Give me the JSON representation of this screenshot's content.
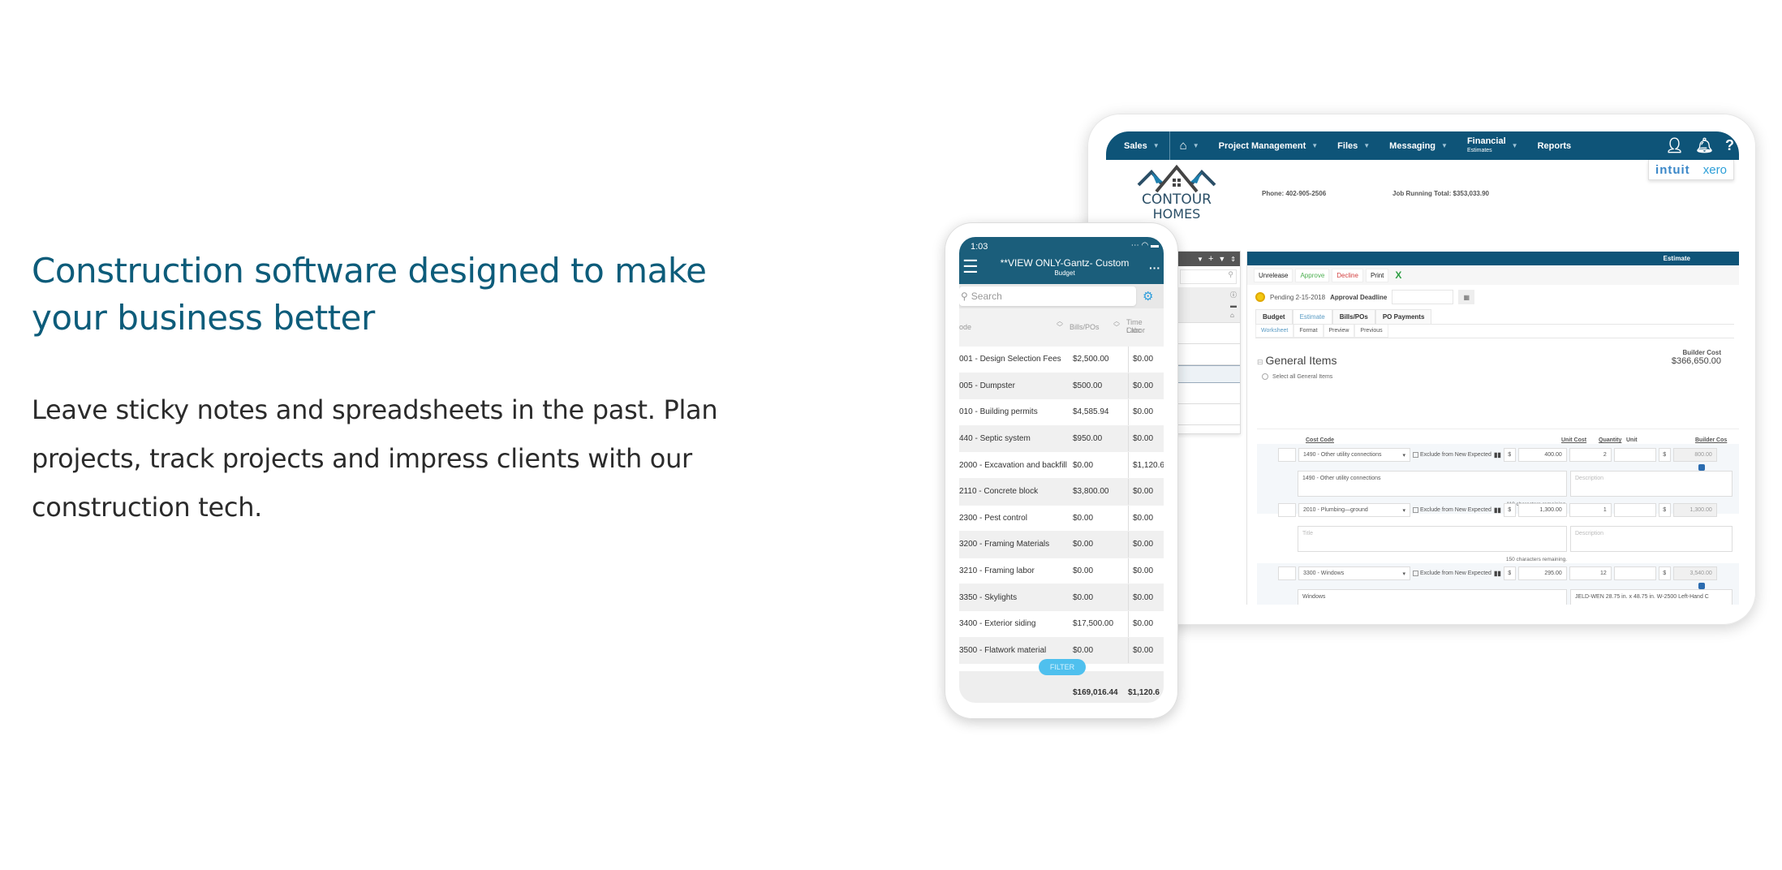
{
  "hero": {
    "title": "Construction software designed to make your business better",
    "body": "Leave sticky notes and spreadsheets in the past. Plan projects, track projects and impress clients with our construction tech."
  },
  "colors": {
    "heading": "#0d5c7a",
    "nav_bar": "#0e5478",
    "phone_header": "#1b5e7b",
    "filter_button": "#4fc0ee",
    "approve": "#4caf50",
    "decline": "#d23c3c"
  },
  "desktop": {
    "nav": {
      "items": [
        {
          "label": "Sales",
          "icon": "chevron-down-icon"
        },
        {
          "label": "",
          "icon": "home-icon"
        },
        {
          "label": "Project Management",
          "icon": "chevron-down-icon"
        },
        {
          "label": "Files",
          "icon": "chevron-down-icon"
        },
        {
          "label": "Messaging",
          "icon": "chevron-down-icon"
        },
        {
          "label": "Financial",
          "sub": "Estimates",
          "icon": "chevron-down-icon"
        },
        {
          "label": "Reports"
        }
      ],
      "right_icons": [
        "user-icon",
        "bell-icon",
        "help-icon"
      ]
    },
    "integrations": {
      "intuit": "intuit",
      "xero": "xero"
    },
    "logo": {
      "line1": "CONTOUR",
      "line2": "HOMES"
    },
    "phone_line": "Phone: 402-905-2506",
    "job_total": "Job Running Total:  $353,033.90",
    "main_header": "Estimate",
    "actions": [
      "Unrelease",
      "Approve",
      "Decline",
      "Print"
    ],
    "status": "Pending 2-15-2018",
    "approval_deadline_label": "Approval Deadline",
    "tabs": [
      "Budget",
      "Estimate",
      "Bills/POs",
      "PO Payments"
    ],
    "active_tab": "Estimate",
    "subtabs": [
      "Worksheet",
      "Format",
      "Preview",
      "Previous"
    ],
    "active_subtab": "Worksheet",
    "section_title": "General Items",
    "select_all": "Select all General Items",
    "builder_cost_label": "Builder Cost",
    "builder_cost_value": "$366,650.00",
    "columns": {
      "cost_code": "Cost Code",
      "unit_cost": "Unit Cost",
      "quantity": "Quantity",
      "unit": "Unit",
      "builder_cost": "Builder Cos"
    },
    "exclude_label": "Exclude from New Expected",
    "currency": "$",
    "items": [
      {
        "code": "1490 - Other utility connections",
        "unit_cost": "400.00",
        "quantity": "2",
        "builder_cost": "800.00",
        "title": "1490 - Other utility connections",
        "title_placeholder": "",
        "description": "Description",
        "chars": "118 characters remaining."
      },
      {
        "code": "2010 - Plumbing—ground",
        "unit_cost": "1,300.00",
        "quantity": "1",
        "builder_cost": "1,300.00",
        "title": "Title",
        "description": "Description",
        "chars": "150 characters remaining."
      },
      {
        "code": "3300 - Windows",
        "unit_cost": "295.00",
        "quantity": "12",
        "builder_cost": "3,540.00",
        "title": "Windows",
        "description": "JELD-WEN 28.75 in. x 48.75 in. W-2500 Left-Hand C"
      }
    ]
  },
  "phone": {
    "time": "1:03",
    "title": "**VIEW ONLY-Gantz- Custom",
    "subtitle": "Budget",
    "search_placeholder": "Search",
    "columns": [
      "ode",
      "Bills/POs",
      "Time Clock Labor"
    ],
    "column_labels": {
      "code": "ode",
      "bills": "Bills/POs",
      "tc1": "Time Cloc",
      "tc2": "Labor"
    },
    "rows": [
      {
        "code": "001 - Design Selection Fees",
        "bills": "$2,500.00",
        "labor": "$0.00"
      },
      {
        "code": "005 - Dumpster",
        "bills": "$500.00",
        "labor": "$0.00"
      },
      {
        "code": "010 - Building permits",
        "bills": "$4,585.94",
        "labor": "$0.00"
      },
      {
        "code": "440 - Septic system",
        "bills": "$950.00",
        "labor": "$0.00"
      },
      {
        "code": "2000 - Excavation and backfill",
        "bills": "$0.00",
        "labor": "$1,120.6"
      },
      {
        "code": "2110 - Concrete block",
        "bills": "$3,800.00",
        "labor": "$0.00"
      },
      {
        "code": "2300 - Pest control",
        "bills": "$0.00",
        "labor": "$0.00"
      },
      {
        "code": "3200 - Framing Materials",
        "bills": "$0.00",
        "labor": "$0.00"
      },
      {
        "code": "3210 - Framing labor",
        "bills": "$0.00",
        "labor": "$0.00"
      },
      {
        "code": "3350 - Skylights",
        "bills": "$0.00",
        "labor": "$0.00"
      },
      {
        "code": "3400 - Exterior siding",
        "bills": "$17,500.00",
        "labor": "$0.00"
      },
      {
        "code": "3500 - Flatwork material",
        "bills": "$0.00",
        "labor": "$0.00"
      }
    ],
    "filter_label": "FILTER",
    "total_bills": "$169,016.44",
    "total_labor": "$1,120.6"
  }
}
